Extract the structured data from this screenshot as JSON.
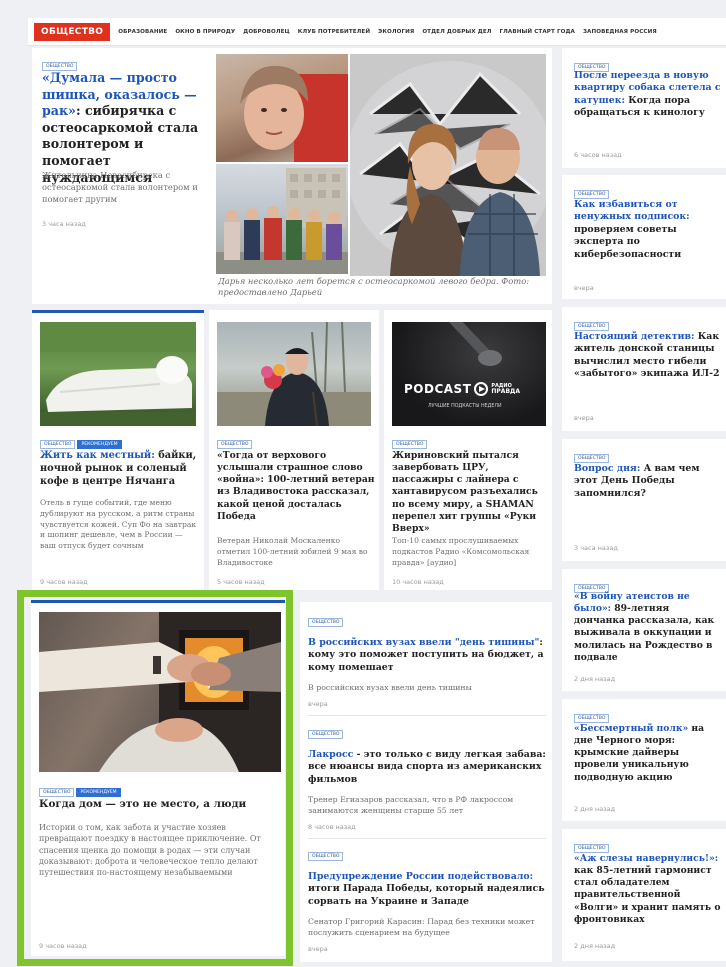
{
  "nav": {
    "main": "ОБЩЕСТВО",
    "items": [
      "ОБРАЗОВАНИЕ",
      "ОКНО В ПРИРОДУ",
      "ДОБРОВОЛЕЦ",
      "КЛУБ ПОТРЕБИТЕЛЕЙ",
      "ЭКОЛОГИЯ",
      "ОТДЕЛ ДОБРЫХ ДЕЛ",
      "ГЛАВНЫЙ СТАРТ ГОДА",
      "ЗАПОВЕДНАЯ РОССИЯ"
    ]
  },
  "tags": {
    "society": "ОБЩЕСТВО",
    "recommend": "РЕКОМЕНДУЕМ"
  },
  "hero": {
    "headline_link": "«Думала — просто шишка, оказалось — рак»",
    "headline_rest": ": сибирячка с остеосаркомой стала волонтером и помогает нуждающимся",
    "desc": "Жительница Новосибирска с остеосаркомой стала волонтером и помогает другим",
    "time": "3 часа назад",
    "caption": "Дарья несколько лет борется с остеосаркомой левого бедра. Фото: предоставлено Дарьей"
  },
  "mid": [
    {
      "link": "Жить как местный:",
      "rest": " байки, ночной рынок и соленый кофе в центре Нячанга",
      "desc": "Отель в гуще событий, где меню дублируют на русском, а ритм страны чувствуется кожей. Суп Фо на завтрак и шопинг дешевле, чем в России — ваш отпуск будет сочным",
      "time": "9 часов назад"
    },
    {
      "link": "",
      "rest": "«Тогда от верхового услышали страшное слово «война»: 100-летний ветеран из Владивостока рассказал, какой ценой досталась Победа",
      "desc": "Ветеран Николай Москаленко отметил 100-летний юбилей 9 мая во Владивостоке",
      "time": "5 часов назад"
    },
    {
      "link": "",
      "rest": "Жириновский пытался завербовать ЦРУ, пассажиры с лайнера с хантавирусом разъехались по всему миру, а SHAMAN перепел хит группы «Руки Вверх»",
      "desc": "Топ-10 самых прослушиваемых подкастов Радио «Комсомольская правда» [аудио]",
      "time": "10 часов назад"
    }
  ],
  "podcast": {
    "word": "PODCAST",
    "brand1": "РАДИО",
    "brand2": "ПРАВДА",
    "sub": "ЛУЧШИЕ ПОДКАСТЫ НЕДЕЛИ"
  },
  "feature": {
    "title": "Когда дом — это не место, а люди",
    "desc": "Истории о том, как забота и участие хозяев превращают поездку в настоящее приключение. От спасения щенка до помощи в родах — эти случаи доказывают: доброта и человеческое тепло делают путешествия по-настоящему незабываемыми",
    "time": "9 часов назад"
  },
  "list": [
    {
      "link": "В российских вузах ввели \"день тишины\"",
      "rest": ": кому это поможет поступить на бюджет, а кому помешает",
      "desc": "В российских вузах ввели день тишины",
      "time": "вчера"
    },
    {
      "link": "Лакросс",
      "rest": " - это только с виду легкая забава: все нюансы вида спорта из американских фильмов",
      "desc": "Тренер Егиазаров рассказал, что в РФ лакроссом занимаются женщины старше 55 лет",
      "time": "8 часов назад"
    },
    {
      "link": "Предупреждение России подействовало:",
      "rest": " итоги Парада Победы, который надеялись сорвать на Украине и Западе",
      "desc": "Сенатор Григорий Карасин: Парад без техники может послужить сценарием на будущее",
      "time": "вчера"
    }
  ],
  "right": [
    {
      "link": "После переезда в новую квартиру собака слетела с катушек:",
      "rest": " Когда пора обращаться к кинологу",
      "time": "6 часов назад"
    },
    {
      "link": "Как избавиться от ненужных подписок:",
      "rest": " проверяем советы эксперта по кибербезопасности",
      "time": "вчера"
    },
    {
      "link": "Настоящий детектив:",
      "rest": " Как житель донской станицы вычислил место гибели «забытого» экипажа ИЛ-2",
      "time": "вчера"
    },
    {
      "link": "Вопрос дня:",
      "rest": " А вам чем этот День Победы запомнился?",
      "time": "3 часа назад"
    },
    {
      "link": "«В войну атеистов не было»:",
      "rest": " 89-летняя дончанка рассказала, как выживала в оккупации и молилась на Рождество в подвале",
      "time": "2 дня назад"
    },
    {
      "link": "«Бессмертный полк»",
      "rest": " на дне Черного моря: крымские дайверы провели уникальную подводную акцию",
      "time": "2 дня назад"
    },
    {
      "link": "«Аж слезы навернулись!»:",
      "rest": " как 85-летний гармонист стал обладателем правительственной «Волги» и хранит память о фронтовиках",
      "time": "2 дня назад"
    }
  ],
  "colors": {
    "accent": "#1e56b5",
    "brand": "#e0301e",
    "highlight_frame": "#7ec42b"
  }
}
